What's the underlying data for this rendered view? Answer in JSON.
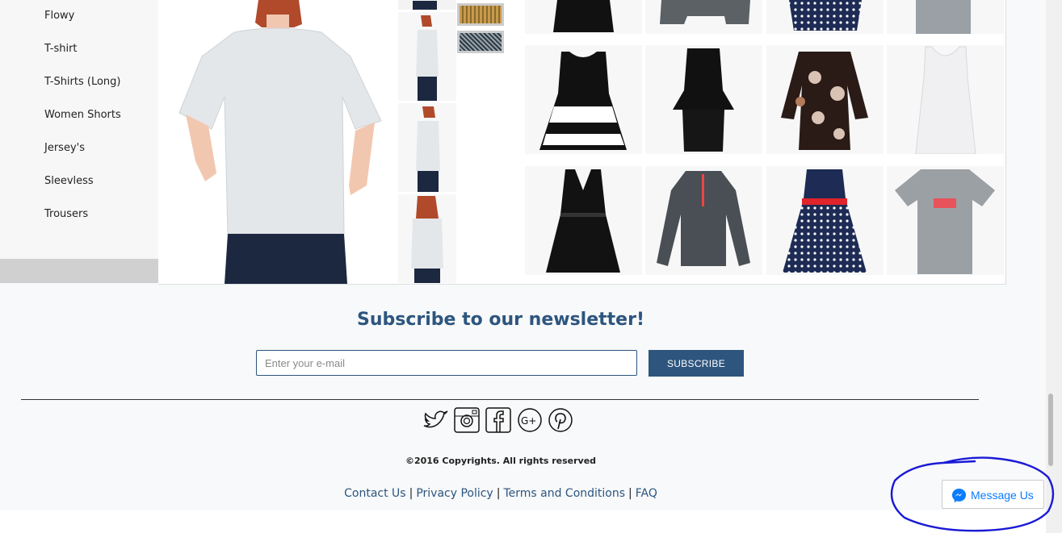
{
  "sidebar": {
    "items": [
      {
        "label": "Flowy"
      },
      {
        "label": "T-shirt"
      },
      {
        "label": "T-Shirts (Long)"
      },
      {
        "label": "Women Shorts"
      },
      {
        "label": "Jersey's"
      },
      {
        "label": "Sleevless"
      },
      {
        "label": "Trousers"
      }
    ]
  },
  "product": {
    "main_image": "woman-white-tshirt-photo",
    "thumbnails": [
      "tshirt-front-thumb",
      "tshirt-side-thumb",
      "tshirt-side-glasses-thumb",
      "tshirt-back-thumb"
    ],
    "swatches": [
      "fabric-stripe-swatch",
      "fabric-pattern-swatch"
    ]
  },
  "gallery": {
    "tiles": [
      "black-dress",
      "grey-jacket",
      "polka-dot-dress",
      "grey-top",
      "black-white-striped-dress",
      "black-peplum-dress",
      "floral-dress",
      "white-tank-top",
      "black-wrap-dress",
      "grey-zip-jacket",
      "polka-dot-red-belt-dress",
      "grey-under-armour-tshirt"
    ]
  },
  "newsletter": {
    "title": "Subscribe to our newsletter!",
    "email_placeholder": "Enter your e-mail",
    "subscribe_label": "SUBSCRIBE"
  },
  "social": [
    "twitter-icon",
    "instagram-icon",
    "facebook-icon",
    "google-plus-icon",
    "pinterest-icon"
  ],
  "footer": {
    "copyright": "©2016 Copyrights. All rights reserved",
    "links": [
      "Contact Us",
      "Privacy Policy",
      "Terms and Conditions",
      "FAQ"
    ]
  },
  "messenger": {
    "label": "Message Us",
    "icon": "messenger-icon"
  },
  "colors": {
    "brand": "#2d557e",
    "messenger": "#0a7cff",
    "annotation": "#1a1ad6"
  }
}
